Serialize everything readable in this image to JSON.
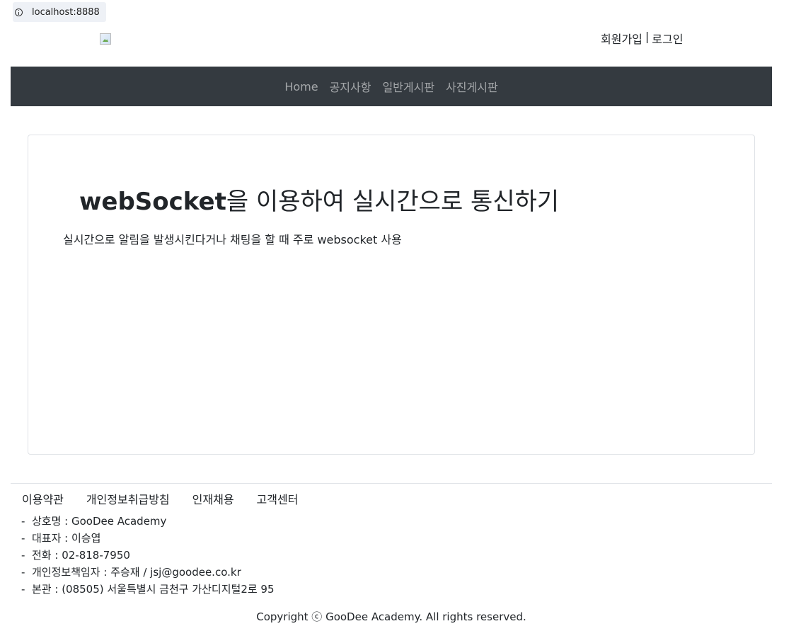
{
  "browser": {
    "url": "localhost:8888"
  },
  "header": {
    "auth": {
      "signup": "회원가입",
      "separator": "|",
      "login": "로그인"
    }
  },
  "nav": {
    "items": [
      {
        "label": "Home"
      },
      {
        "label": "공지사항"
      },
      {
        "label": "일반게시판"
      },
      {
        "label": "사진게시판"
      }
    ],
    "background_color": "#343a40"
  },
  "main": {
    "title_bold": "webSocket",
    "title_rest": "을 이용하여 실시간으로 통신하기",
    "description": "실시간으로 알림을 발생시킨다거나 채팅을 할 때 주로 websocket 사용"
  },
  "footer": {
    "links": [
      {
        "label": "이용약관"
      },
      {
        "label": "개인정보취급방침"
      },
      {
        "label": "인재채용"
      },
      {
        "label": "고객센터"
      }
    ],
    "info": [
      "상호명 : GooDee Academy",
      "대표자 : 이승엽",
      "전화 : 02-818-7950",
      "개인정보책임자 : 주승재 / jsj@goodee.co.kr",
      "본관 : (08505) 서울특별시 금천구 가산디지털2로 95"
    ],
    "copyright": "Copyright ⓒ GooDee Academy. All rights reserved."
  }
}
